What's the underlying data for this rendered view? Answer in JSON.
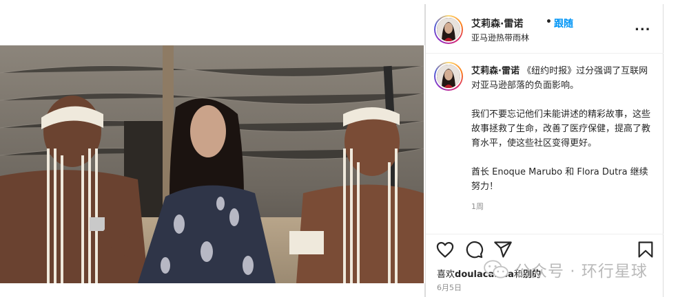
{
  "post": {
    "username": "艾莉森·雷诺",
    "separator": "•",
    "follow_label": "跟随",
    "location": "亚马逊热带雨林",
    "more_label": "...",
    "caption": {
      "username": "艾莉森·雷诺",
      "paragraph_1": "《纽约时报》过分强调了互联网对亚马逊部落的负面影响。",
      "paragraph_2": "我们不要忘记他们未能讲述的精彩故事，这些故事拯救了生命，改善了医疗保健，提高了教育水平，使这些社区变得更好。",
      "paragraph_3": "酋长 Enoque Marubo 和 Flora Dutra 继续努力！"
    },
    "time_ago": "1周",
    "likes": {
      "prefix": "喜欢",
      "user": "doulacaissa",
      "and": "和",
      "others": "别的"
    },
    "date": "6月5日"
  },
  "icons": [
    "more-options-icon",
    "heart-icon",
    "comment-icon",
    "share-icon",
    "bookmark-icon",
    "wechat-icon"
  ],
  "watermark": "公众号 · 环行星球",
  "colors": {
    "follow_blue": "#0095f6",
    "secondary_text": "#8e8e8e",
    "border": "#dbdbdb"
  }
}
